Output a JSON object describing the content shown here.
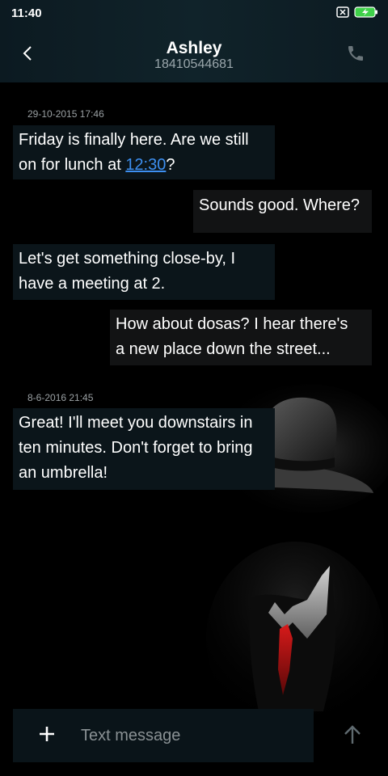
{
  "status_bar": {
    "time": "11:40",
    "icons": [
      "no-sim-icon",
      "battery-charging-icon"
    ]
  },
  "header": {
    "contact_name": "Ashley",
    "contact_number": "18410544681",
    "back_icon": "chevron-left-icon",
    "call_icon": "phone-icon"
  },
  "conversation": {
    "timestamps": [
      "29-10-2015 17:46",
      "8-6-2016 21:45"
    ],
    "messages": [
      {
        "direction": "incoming",
        "line1": "Friday is finally here. Are we still",
        "line2_prefix": "on for lunch at ",
        "line2_link": "12:30",
        "line2_suffix": "?"
      },
      {
        "direction": "outgoing",
        "line1": "Sounds good. Where?"
      },
      {
        "direction": "incoming",
        "line1": "Let's get something close-by, I",
        "line2": "have a meeting at 2."
      },
      {
        "direction": "outgoing",
        "line1": "How about dosas? I hear there's",
        "line2": "a new place down the street..."
      },
      {
        "direction": "incoming",
        "line1": "Great! I'll meet you downstairs in",
        "line2": "ten minutes. Don't forget to bring",
        "line3": "an umbrella!"
      }
    ]
  },
  "composer": {
    "placeholder": "Text message",
    "value": "",
    "attach_icon": "plus-icon",
    "send_icon": "arrow-up-icon"
  },
  "colors": {
    "header_bg": "#10232a",
    "incoming_bubble": "#0b151a",
    "outgoing_bubble": "#121314",
    "link": "#3d8ff0",
    "battery": "#3fd14a"
  }
}
